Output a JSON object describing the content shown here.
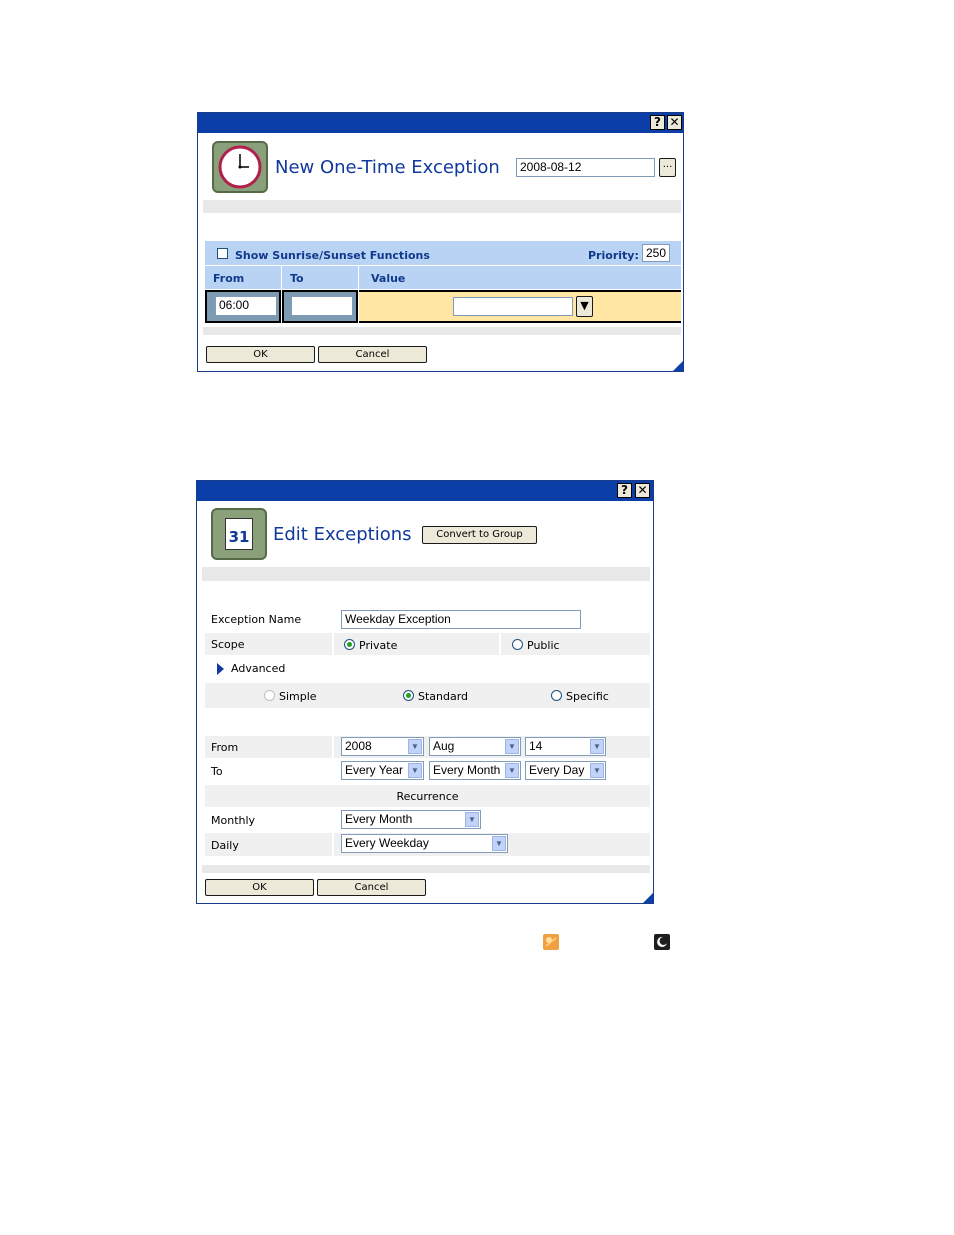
{
  "dialog1": {
    "help_glyph": "?",
    "close_glyph": "✕",
    "title": "New One-Time Exception",
    "date_value": "2008-08-12",
    "date_picker_label": "...",
    "sunrise_label": "Show Sunrise/Sunset Functions",
    "priority_label": "Priority:",
    "priority_value": "250",
    "columns": {
      "from": "From",
      "to": "To",
      "value": "Value"
    },
    "from_value": "06:00",
    "to_value": "",
    "value_select": "",
    "dropdown_glyph": "▼",
    "ok_label": "OK",
    "cancel_label": "Cancel"
  },
  "dialog2": {
    "help_glyph": "?",
    "close_glyph": "✕",
    "calendar_number": "31",
    "title": "Edit Exceptions",
    "convert_label": "Convert to Group",
    "name_label": "Exception Name",
    "name_value": "Weekday Exception",
    "scope_label": "Scope",
    "scope_private": "Private",
    "scope_public": "Public",
    "advanced_label": "Advanced",
    "mode_simple": "Simple",
    "mode_standard": "Standard",
    "mode_specific": "Specific",
    "from_label": "From",
    "from_year": "2008",
    "from_month": "Aug",
    "from_day": "14",
    "to_label": "To",
    "to_year": "Every Year",
    "to_month": "Every Month",
    "to_day": "Every Day",
    "recurrence_label": "Recurrence",
    "monthly_label": "Monthly",
    "monthly_value": "Every Month",
    "daily_label": "Daily",
    "daily_value": "Every Weekday",
    "ok_label": "OK",
    "cancel_label": "Cancel",
    "arrow_glyph": "▼"
  },
  "colors": {
    "titlebar": "#0b3ea6",
    "header_blue": "#b9d3f5",
    "value_yellow": "#ffe6a3",
    "title_text": "#10399c"
  }
}
